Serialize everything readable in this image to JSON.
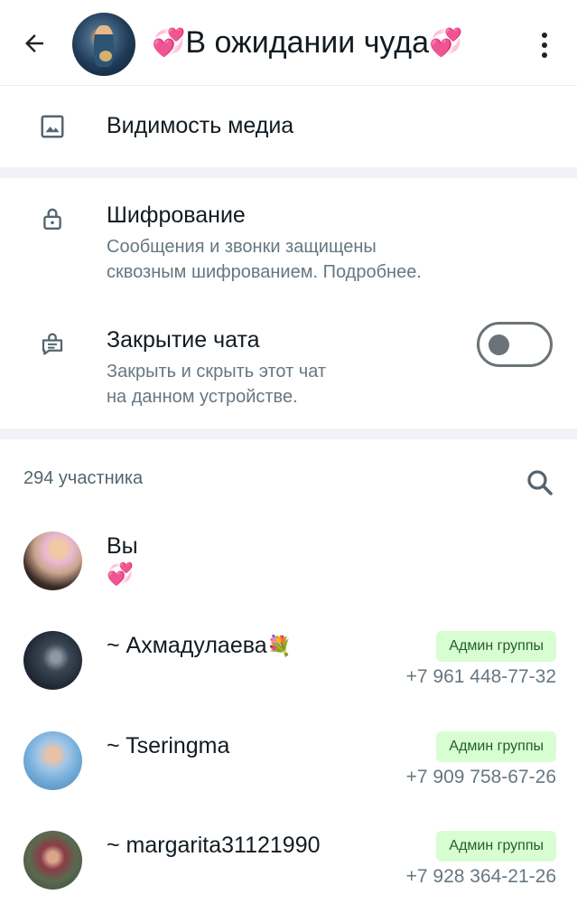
{
  "header": {
    "title": "В ожидании чуда",
    "title_prefix_emoji": "💞",
    "title_suffix_emoji": "💞",
    "back_icon": "arrow-left-icon",
    "menu_icon": "more-vert-icon"
  },
  "media_visibility": {
    "label": "Видимость медиа",
    "icon": "image-icon"
  },
  "encryption": {
    "title": "Шифрование",
    "subtitle_line1": "Сообщения и звонки защищены",
    "subtitle_line2": "сквозным шифрованием. Подробнее.",
    "icon": "lock-icon"
  },
  "chat_lock": {
    "title": "Закрытие чата",
    "subtitle_line1": "Закрыть и скрыть этот чат",
    "subtitle_line2": "на данном устройстве.",
    "icon": "chat-lock-icon",
    "enabled": false
  },
  "participants": {
    "count_label": "294 участника",
    "search_icon": "search-icon",
    "members": [
      {
        "name": "Вы",
        "status": "💞",
        "badge": "",
        "phone": ""
      },
      {
        "name": "~ Ахмадулаева",
        "name_emoji": "💐",
        "badge": "Админ группы",
        "phone": "+7 961 448-77-32"
      },
      {
        "name": "~ Tseringma",
        "badge": "Админ группы",
        "phone": "+7 909 758-67-26"
      },
      {
        "name": "~ margarita31121990",
        "badge": "Админ группы",
        "phone": "+7 928 364-21-26"
      }
    ]
  },
  "colors": {
    "admin_badge_bg": "#d9fdd3",
    "admin_badge_text": "#1f5e30",
    "secondary_text": "#667781",
    "section_gap": "#f0f2f5"
  }
}
